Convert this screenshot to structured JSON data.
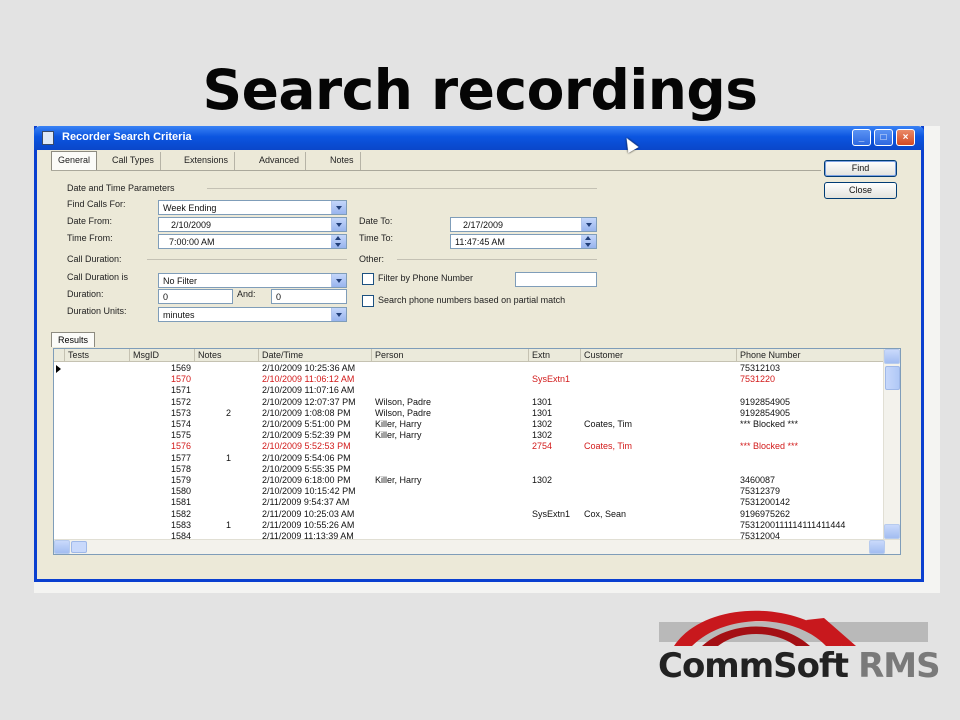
{
  "slide": {
    "title": "Search recordings"
  },
  "window": {
    "title": "Recorder Search Criteria",
    "controls": {
      "minimize": "_",
      "maximize": "□",
      "close": "×"
    }
  },
  "tabs": [
    "General",
    "Call Types",
    "Extensions",
    "Advanced",
    "Notes"
  ],
  "buttons": {
    "find": "Find",
    "close": "Close"
  },
  "form": {
    "date_time_group": "Date and Time Parameters",
    "find_calls_for": {
      "label": "Find Calls For:",
      "value": "Week Ending"
    },
    "date_from": {
      "label": "Date From:",
      "value": "2/10/2009"
    },
    "date_to": {
      "label": "Date To:",
      "value": "2/17/2009"
    },
    "time_from": {
      "label": "Time From:",
      "value": "7:00:00 AM"
    },
    "time_to": {
      "label": "Time To:",
      "value": "11:47:45 AM"
    },
    "call_duration_group": "Call Duration:",
    "call_duration_is": {
      "label": "Call Duration is",
      "value": "No Filter"
    },
    "duration": {
      "label": "Duration:",
      "value": "0",
      "and_label": "And:",
      "and_value": "0"
    },
    "duration_units": {
      "label": "Duration Units:",
      "value": "minutes"
    },
    "other_group": "Other:",
    "filter_phone": {
      "label": "Filter by Phone Number",
      "checked": false,
      "value": ""
    },
    "partial_match": {
      "label": "Search phone numbers based on partial match",
      "checked": false
    }
  },
  "results": {
    "tab_label": "Results",
    "columns": [
      "Tests",
      "MsgID",
      "Notes",
      "Date/Time",
      "Person",
      "Extn",
      "Customer",
      "Phone Number"
    ],
    "rows": [
      {
        "msgid": "1569",
        "notes": "",
        "datetime": "2/10/2009 10:25:36 AM",
        "person": "",
        "extn": "",
        "customer": "",
        "phone": "75312103",
        "highlight": false,
        "current": true
      },
      {
        "msgid": "1570",
        "notes": "",
        "datetime": "2/10/2009 11:06:12 AM",
        "person": "",
        "extn": "SysExtn1",
        "customer": "",
        "phone": "7531220",
        "highlight": true,
        "current": false
      },
      {
        "msgid": "1571",
        "notes": "",
        "datetime": "2/10/2009 11:07:16 AM",
        "person": "",
        "extn": "",
        "customer": "",
        "phone": "",
        "highlight": false,
        "current": false
      },
      {
        "msgid": "1572",
        "notes": "",
        "datetime": "2/10/2009 12:07:37 PM",
        "person": "Wilson, Padre",
        "extn": "1301",
        "customer": "",
        "phone": "9192854905",
        "highlight": false,
        "current": false
      },
      {
        "msgid": "1573",
        "notes": "2",
        "datetime": "2/10/2009 1:08:08 PM",
        "person": "Wilson, Padre",
        "extn": "1301",
        "customer": "",
        "phone": "9192854905",
        "highlight": false,
        "current": false
      },
      {
        "msgid": "1574",
        "notes": "",
        "datetime": "2/10/2009 5:51:00 PM",
        "person": "Killer, Harry",
        "extn": "1302",
        "customer": "Coates, Tim",
        "phone": "*** Blocked ***",
        "highlight": false,
        "current": false
      },
      {
        "msgid": "1575",
        "notes": "",
        "datetime": "2/10/2009 5:52:39 PM",
        "person": "Killer, Harry",
        "extn": "1302",
        "customer": "",
        "phone": "",
        "highlight": false,
        "current": false
      },
      {
        "msgid": "1576",
        "notes": "",
        "datetime": "2/10/2009 5:52:53 PM",
        "person": "",
        "extn": "2754",
        "customer": "Coates, Tim",
        "phone": "*** Blocked ***",
        "highlight": true,
        "current": false
      },
      {
        "msgid": "1577",
        "notes": "1",
        "datetime": "2/10/2009 5:54:06 PM",
        "person": "",
        "extn": "",
        "customer": "",
        "phone": "",
        "highlight": false,
        "current": false
      },
      {
        "msgid": "1578",
        "notes": "",
        "datetime": "2/10/2009 5:55:35 PM",
        "person": "",
        "extn": "",
        "customer": "",
        "phone": "",
        "highlight": false,
        "current": false
      },
      {
        "msgid": "1579",
        "notes": "",
        "datetime": "2/10/2009 6:18:00 PM",
        "person": "Killer, Harry",
        "extn": "1302",
        "customer": "",
        "phone": "3460087",
        "highlight": false,
        "current": false
      },
      {
        "msgid": "1580",
        "notes": "",
        "datetime": "2/10/2009 10:15:42 PM",
        "person": "",
        "extn": "",
        "customer": "",
        "phone": "75312379",
        "highlight": false,
        "current": false
      },
      {
        "msgid": "1581",
        "notes": "",
        "datetime": "2/11/2009 9:54:37 AM",
        "person": "",
        "extn": "",
        "customer": "",
        "phone": "7531200142",
        "highlight": false,
        "current": false
      },
      {
        "msgid": "1582",
        "notes": "",
        "datetime": "2/11/2009 10:25:03 AM",
        "person": "",
        "extn": "SysExtn1",
        "customer": "Cox, Sean",
        "phone": "9196975262",
        "highlight": false,
        "current": false
      },
      {
        "msgid": "1583",
        "notes": "1",
        "datetime": "2/11/2009 10:55:26 AM",
        "person": "",
        "extn": "",
        "customer": "",
        "phone": "7531200111114111411444",
        "highlight": false,
        "current": false
      },
      {
        "msgid": "1584",
        "notes": "",
        "datetime": "2/11/2009 11:13:39 AM",
        "person": "",
        "extn": "",
        "customer": "",
        "phone": "75312004",
        "highlight": false,
        "current": false
      }
    ]
  },
  "logo": {
    "text_main": "CommSoft",
    "text_sub": "RMS"
  },
  "colors": {
    "title_bar": "#0b55e0",
    "highlight_row": "#d21a1a",
    "logo_red": "#c8181d"
  }
}
